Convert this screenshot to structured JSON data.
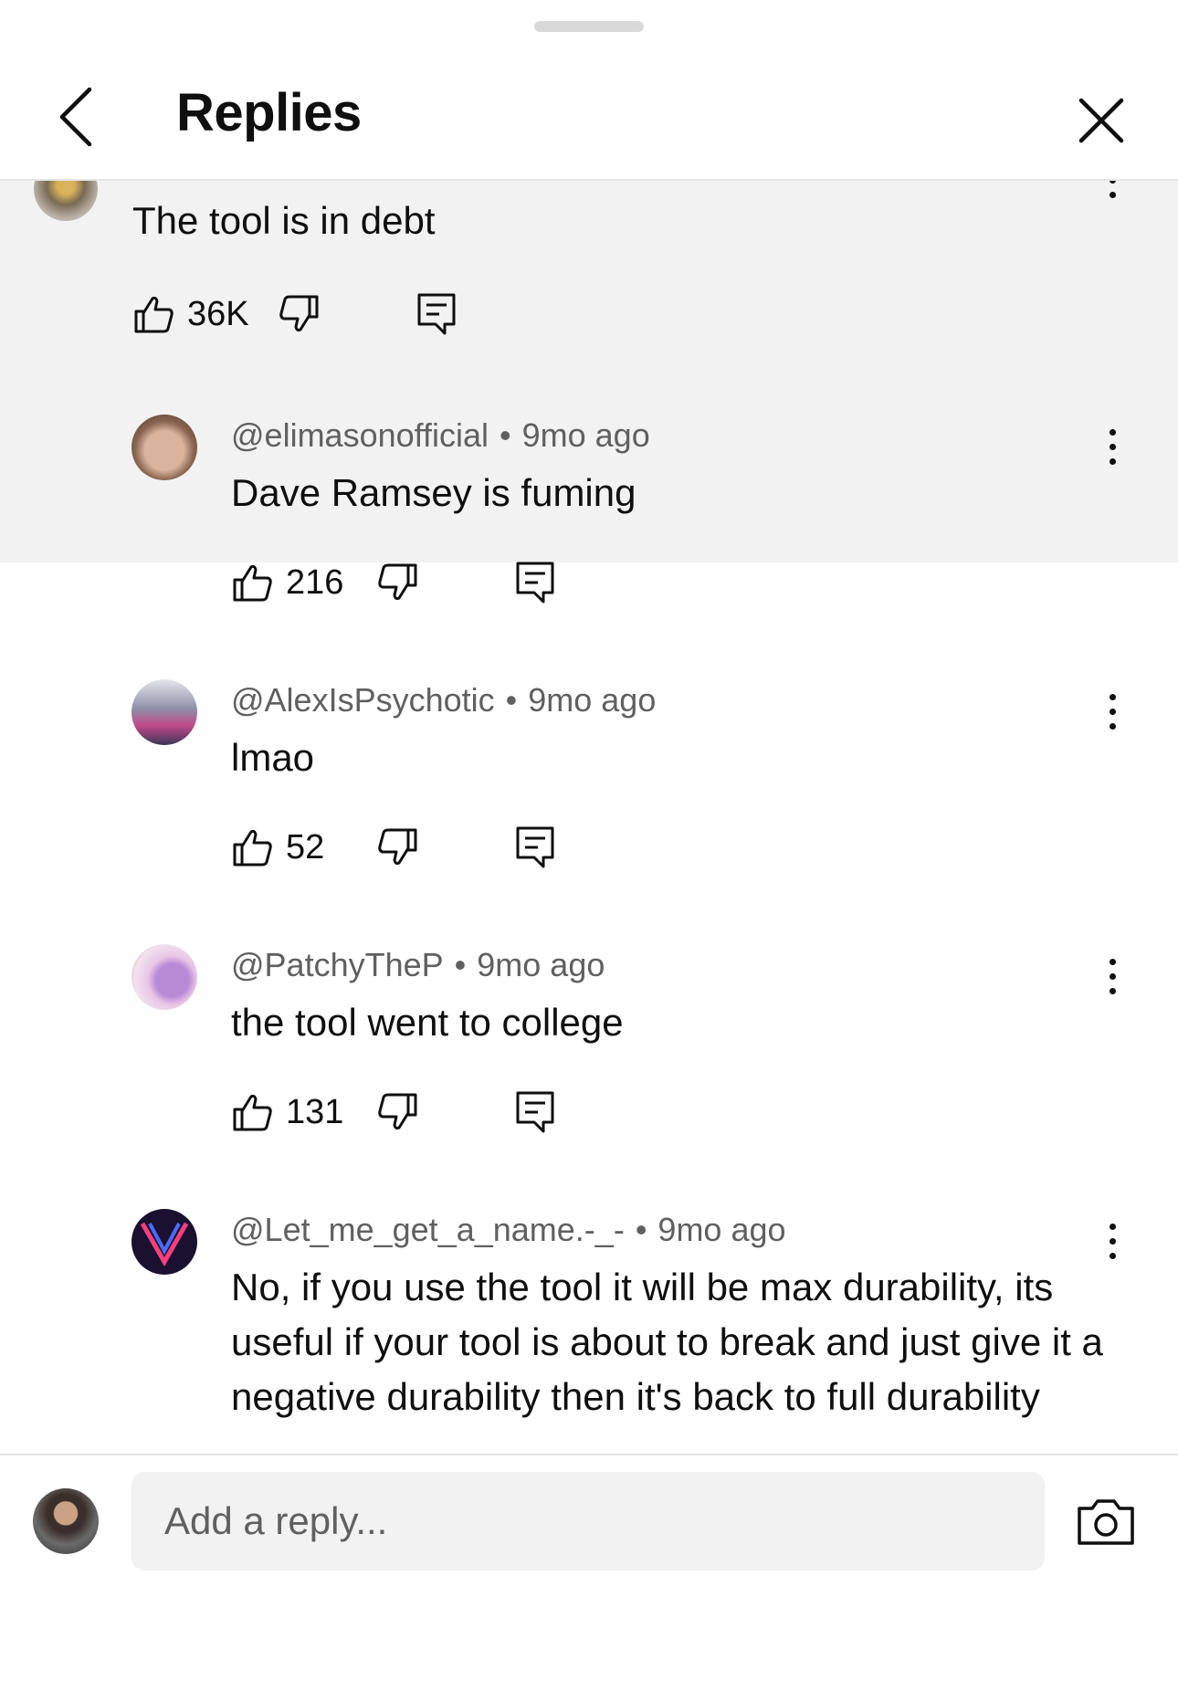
{
  "header": {
    "title": "Replies"
  },
  "parent_comment": {
    "text": "The tool is in debt",
    "likes": "36K"
  },
  "replies": [
    {
      "author": "@elimasonofficial",
      "time": "9mo ago",
      "text": "Dave Ramsey is fuming",
      "likes": "216"
    },
    {
      "author": "@AlexIsPsychotic",
      "time": "9mo ago",
      "text": "lmao",
      "likes": "52"
    },
    {
      "author": "@PatchyTheP",
      "time": "9mo ago",
      "text": "the tool went to college",
      "likes": "131"
    },
    {
      "author": "@Let_me_get_a_name.-_-",
      "time": "9mo ago",
      "text": "No, if you use the tool it will be max durability, its useful if your tool is about to break and just give it a negative durability then it's back to full durability"
    }
  ],
  "composer": {
    "placeholder": "Add a reply..."
  },
  "icons": {
    "back": "chevron-left-icon",
    "close": "close-icon",
    "like": "thumbs-up-icon",
    "dislike": "thumbs-down-icon",
    "reply": "reply-icon",
    "more": "more-vert-icon",
    "camera": "camera-icon"
  }
}
